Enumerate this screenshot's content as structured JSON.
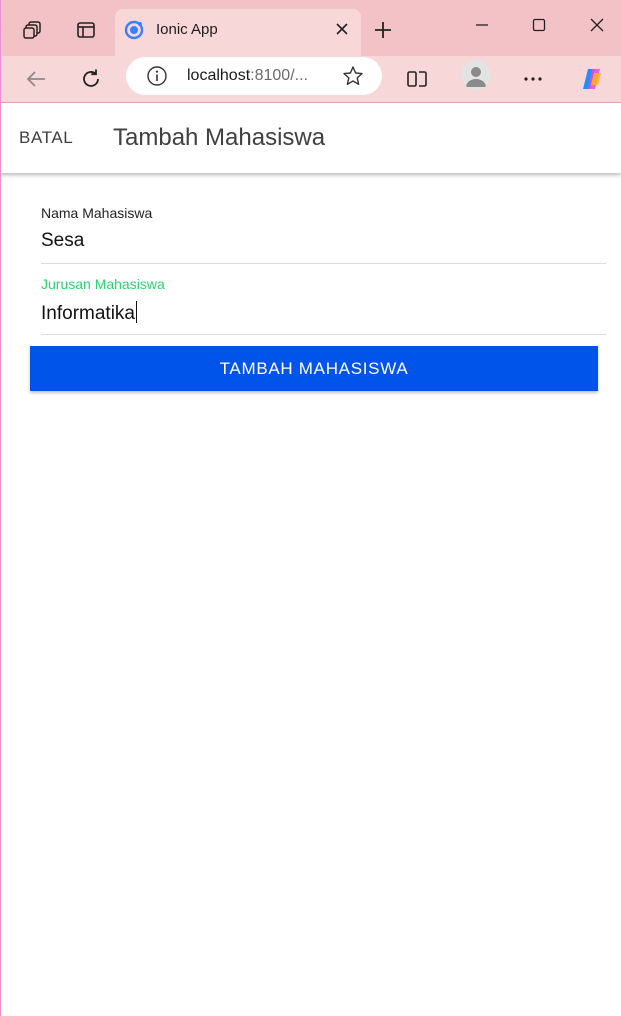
{
  "browser": {
    "tab": {
      "title": "Ionic App"
    },
    "address": {
      "host": "localhost",
      "rest": ":8100/..."
    }
  },
  "header": {
    "cancel_label": "BATAL",
    "title": "Tambah Mahasiswa"
  },
  "form": {
    "fields": [
      {
        "label": "Nama Mahasiswa",
        "value": "Sesa"
      },
      {
        "label": "Jurusan Mahasiswa",
        "value": "Informatika",
        "focused": true
      }
    ],
    "submit_label": "TAMBAH MAHASISWA"
  },
  "colors": {
    "browser_titlebar": "#f3c2c6",
    "browser_toolbar": "#f8d7d9",
    "primary_button": "#0054e9",
    "focused_label": "#2dd36f"
  }
}
